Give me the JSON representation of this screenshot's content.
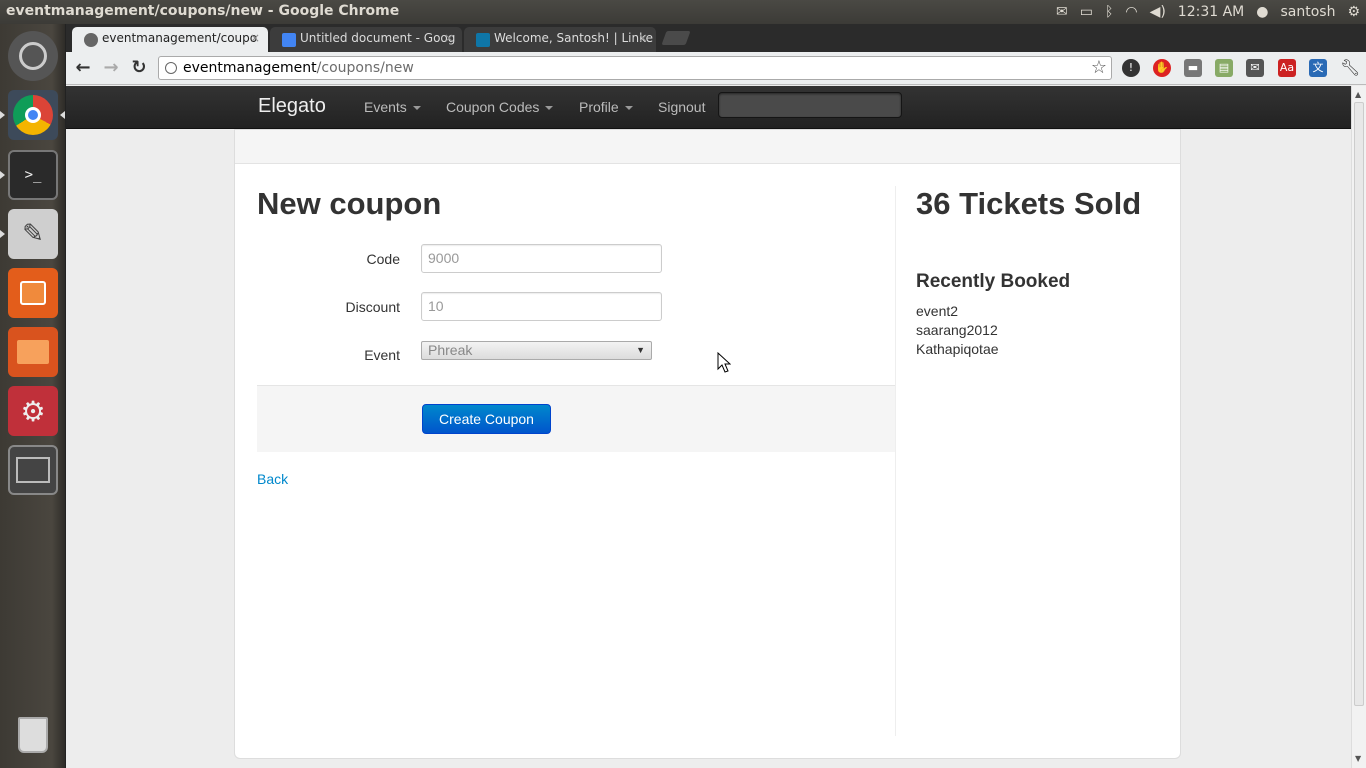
{
  "window": {
    "title": "eventmanagement/coupons/new - Google Chrome"
  },
  "system_tray": {
    "time": "12:31 AM",
    "user": "santosh"
  },
  "tabs": [
    {
      "label": "eventmanagement/coupo"
    },
    {
      "label": "Untitled document - Goog"
    },
    {
      "label": "Welcome, Santosh! | Linke"
    }
  ],
  "address_bar": {
    "host": "eventmanagement",
    "path": "/coupons/new"
  },
  "navbar": {
    "brand": "Elegato",
    "items": [
      {
        "label": "Events"
      },
      {
        "label": "Coupon Codes"
      },
      {
        "label": "Profile"
      },
      {
        "label": "Signout"
      }
    ]
  },
  "form": {
    "title": "New coupon",
    "code_label": "Code",
    "code_placeholder": "9000",
    "discount_label": "Discount",
    "discount_placeholder": "10",
    "event_label": "Event",
    "event_selected": "Phreak",
    "submit_label": "Create Coupon",
    "back_label": "Back"
  },
  "sidebar": {
    "tickets_sold": "36 Tickets Sold",
    "recent_title": "Recently Booked",
    "recent_items": [
      "event2",
      "saarang2012",
      "Kathapiqotae"
    ]
  },
  "colors": {
    "primary_button": "#0074cc",
    "link": "#0088cc",
    "navbar": "#222222"
  }
}
